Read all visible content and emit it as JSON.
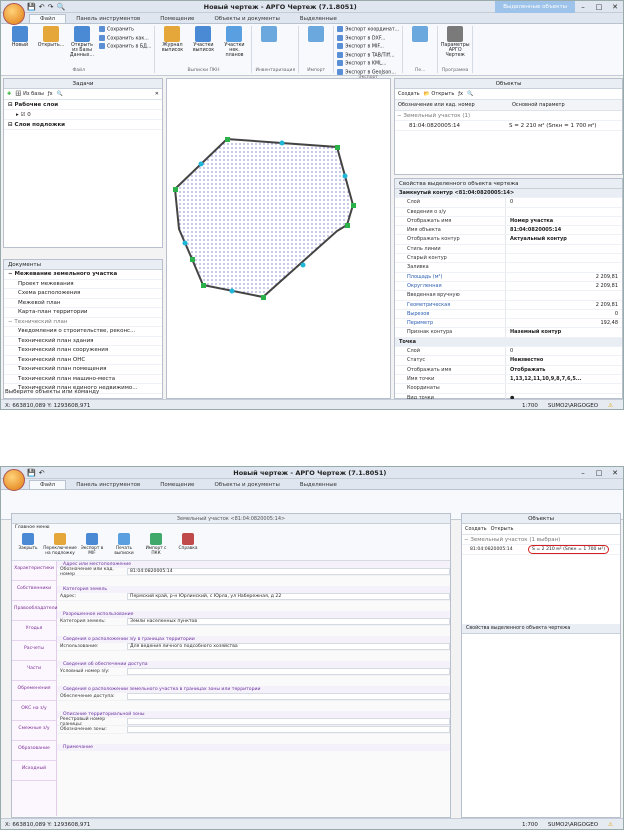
{
  "app": {
    "title": "Новый чертеж - АРГО Чертеж (7.1.8051)",
    "context_tab": "Выделенные объекты"
  },
  "tabs": [
    "Файл",
    "Панель инструментов",
    "Помещение",
    "Объекты и документы",
    "Выделенные"
  ],
  "ribbon": {
    "groups": [
      {
        "label": "Файл",
        "big": [
          "Новый",
          "Открыть...",
          "Открыть из Базы Данных..."
        ],
        "small": [
          "Сохранить",
          "Сохранить как...",
          "Сохранить в БД..."
        ]
      },
      {
        "label": "Выписки ПКН",
        "big": [
          "Журнал выписок",
          "Участки выписок",
          "Участки нек. планов"
        ]
      },
      {
        "label": "Инвентаризация",
        "big": []
      },
      {
        "label": "Импорт",
        "big": []
      },
      {
        "label": "Экспорт",
        "small": [
          "Экспорт координат...",
          "Экспорт в DXF...",
          "Экспорт в MIF...",
          "Экспорт в TAB/Tiff...",
          "Экспорт в KML...",
          "Экспорт в GeoJson..."
        ]
      },
      {
        "label": "Пе...",
        "big": []
      },
      {
        "label": "Программа",
        "big": [
          "Параметры АРГО Чертеж"
        ]
      }
    ]
  },
  "tasks": {
    "title": "Задачи",
    "from_db": "Из базы",
    "work_layers": "Рабочие слои",
    "layer_value": "0",
    "underlay_layers": "Слои подложки"
  },
  "docs": {
    "title": "Документы",
    "items": [
      {
        "t": "Межевание земельного участка",
        "s": "head"
      },
      {
        "t": "Проект межевания",
        "s": "item"
      },
      {
        "t": "Схема расположения",
        "s": "item"
      },
      {
        "t": "Межевой план",
        "s": "item"
      },
      {
        "t": "Карта-план территории",
        "s": "item"
      },
      {
        "t": "Технический план",
        "s": "head2"
      },
      {
        "t": "Уведомления о строительстве, реконс...",
        "s": "item"
      },
      {
        "t": "Технический план здания",
        "s": "item"
      },
      {
        "t": "Технический план сооружения",
        "s": "item"
      },
      {
        "t": "Технический план ОНС",
        "s": "item"
      },
      {
        "t": "Технический план помещения",
        "s": "item"
      },
      {
        "t": "Технический план машино-места",
        "s": "item"
      },
      {
        "t": "Технический план единого недвижимо...",
        "s": "item"
      }
    ]
  },
  "objects": {
    "title": "Объекты",
    "create": "Создать",
    "open": "Открыть",
    "col1": "Обозначение или кад. номер",
    "col2": "Основной параметр",
    "group": "Земельный участок (1)",
    "item_num": "81:04:0820005:14",
    "item_param": "S = 2 210 м² (Sпкн = 1 700 м²)"
  },
  "props": {
    "title": "Свойства выделенного объекта чертежа",
    "header": "Замкнутый контур <81:04:0820005:14>",
    "rows": [
      [
        "Слой",
        "0",
        ""
      ],
      [
        "Сведения о з/у",
        "",
        ""
      ],
      [
        "Отображать имя",
        "Номер участка",
        "b"
      ],
      [
        "Имя объекта",
        "81:04:0820005:14",
        "b"
      ],
      [
        "Отображать контур",
        "Актуальный контур",
        "b"
      ],
      [
        "Стиль линии",
        "",
        ""
      ],
      [
        "Старый контур",
        "",
        ""
      ],
      [
        "Заливка",
        "",
        ""
      ],
      [
        "Площадь (м²)",
        "2 209,81",
        "r"
      ],
      [
        "Округленная",
        "2 209,81",
        "r"
      ],
      [
        "Введенная вручную",
        "",
        ""
      ],
      [
        "Геометрическая",
        "2 209,81",
        "r"
      ],
      [
        "Вырезов",
        "0",
        "r"
      ],
      [
        "Периметр",
        "192,48",
        "r"
      ],
      [
        "Признак контура",
        "Наземный контур",
        "b"
      ]
    ],
    "point_header": "Точка",
    "point_rows": [
      [
        "Слой",
        "0",
        ""
      ],
      [
        "Статус",
        "Неизвестно",
        "b"
      ],
      [
        "Отображать имя",
        "Отображать",
        "b"
      ],
      [
        "Имя точки",
        "1,13,12,11,10,9,8,7,6,5...",
        "b"
      ],
      [
        "Координаты",
        "",
        ""
      ],
      [
        "Вид точки",
        "●",
        ""
      ],
      [
        "Отображать точку",
        "✔",
        ""
      ],
      [
        "Погрешность точки Mt (м)",
        "",
        ""
      ]
    ]
  },
  "status": {
    "coords": "X: 663810,089 Y: 1293608,971",
    "scale": "1:700",
    "user": "SUMO2\\ARGOGEO",
    "hint": "Выберите объекты или команду"
  },
  "form": {
    "window_title": "Земельный участок <81:04:0820005:14>",
    "home_tab": "Главное меню",
    "buttons": [
      "Закрыть",
      "Переключение на подложку",
      "Экспорт в MIF",
      "Печать выписки",
      "Импорт с ПКК",
      "Справка"
    ],
    "side": [
      "Характеристики",
      "Собственники",
      "Правообладатели",
      "Угодья",
      "Расчеты",
      "Части",
      "Обременения",
      "ОКС на з/у",
      "Смежные з/у",
      "Образование",
      "Исходный"
    ],
    "rows": [
      {
        "k": "Обозначение или кад. номер",
        "v": "81:04:0820005:14"
      },
      {
        "k": "Адрес:",
        "v": "Пермский край, р-н Юрлинский, с Юрла, ул Набережная, д 22"
      },
      {
        "k": "Категория земель:",
        "v": "Земли населенных пунктов"
      },
      {
        "k": "Использование:",
        "v": "Для ведения личного подсобного хозяйства"
      },
      {
        "k": "Условный номер з/у:",
        "v": ""
      },
      {
        "k": "Обеспечение доступа:",
        "v": ""
      },
      {
        "k": "Реестровый номер границы:",
        "v": ""
      },
      {
        "k": "Обозначение зоны:",
        "v": ""
      },
      {
        "k": "Вид зоны:",
        "v": ""
      }
    ],
    "sections": [
      "Адрес или местоположение",
      "Категория земель",
      "Разрешенное использование",
      "Сведения о расположении з/у в границах территории",
      "Сведения об обеспечении доступа",
      "Сведения о расположении земельного участка в границах зоны или территории",
      "Описание территориальной зоны",
      "Примечание"
    ]
  },
  "objects2": {
    "title": "Объекты",
    "group": "Земельный участок (1 выбран)",
    "item_num": "81:04:0820005:14",
    "item_param": "S = 2 210 м² (Sпкн = 1 700 м²)",
    "props_title": "Свойства выделенного объекта чертежа"
  }
}
